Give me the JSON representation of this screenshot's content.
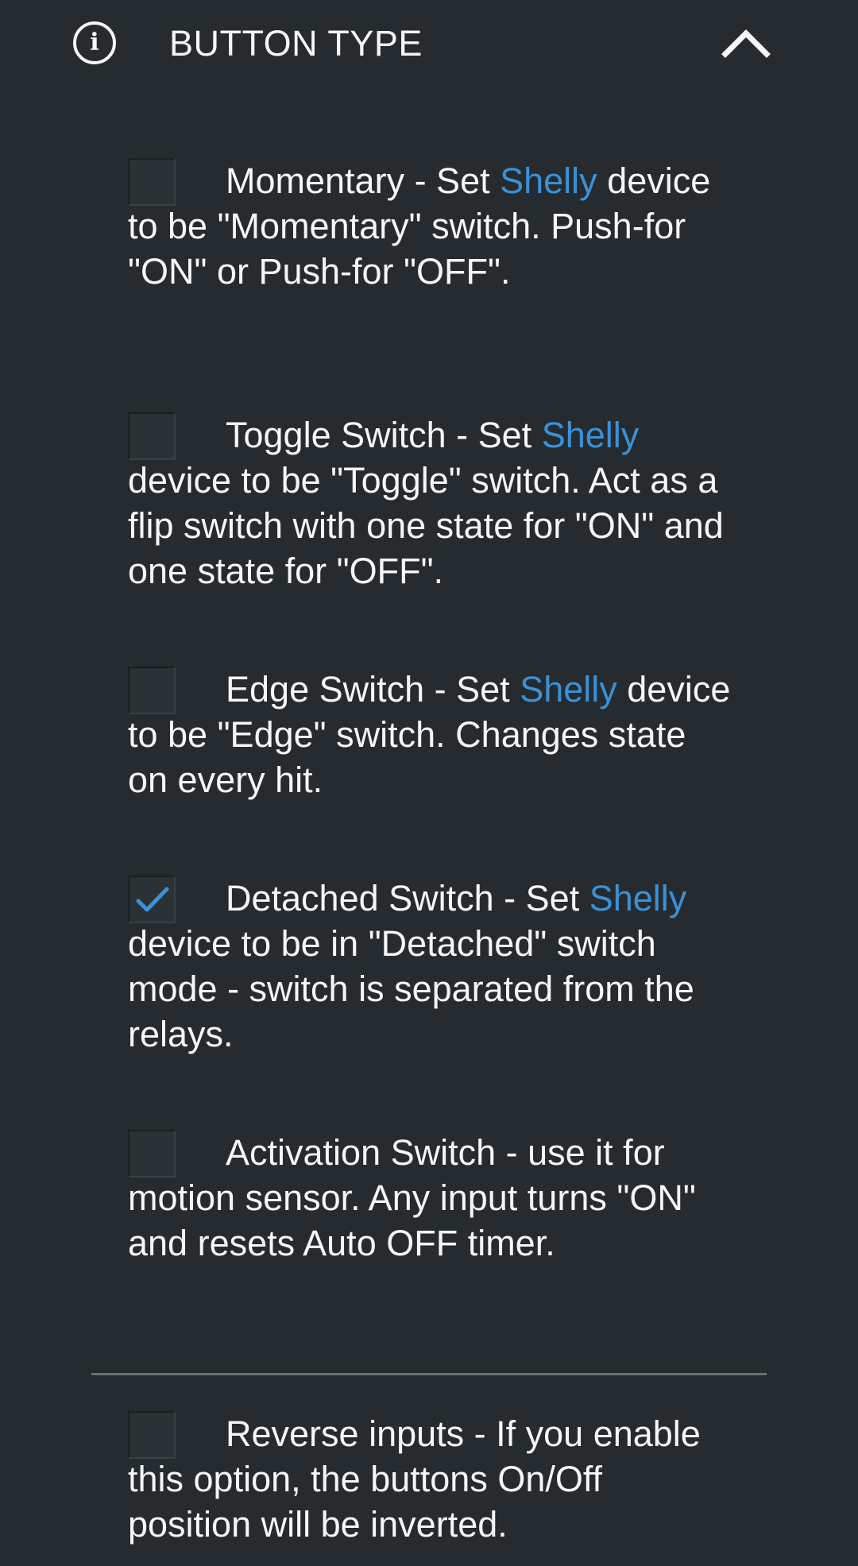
{
  "section": {
    "title": "BUTTON TYPE",
    "info_icon_glyph": "i",
    "info_icon": "info-circle-icon",
    "collapse_icon": "chevron-up-icon"
  },
  "colors": {
    "background": "#252b2e",
    "text": "#f4f6f7",
    "link": "#3a91d8",
    "check": "#3a91d8",
    "divider": "#6b7073"
  },
  "options": [
    {
      "checked": false,
      "title_prefix": "Momentary - Set ",
      "link_text": "Shelly",
      "text_after": " device to be \"Momentary\" switch. Push-for \"ON\" or Push-for \"OFF\"."
    },
    {
      "checked": false,
      "title_prefix": "Toggle Switch - Set ",
      "link_text": "Shelly",
      "text_after": " device to be \"Toggle\" switch. Act as a flip switch with one state for \"ON\" and one state for \"OFF\"."
    },
    {
      "checked": false,
      "title_prefix": "Edge Switch - Set ",
      "link_text": "Shelly",
      "text_after": " device to be \"Edge\" switch. Changes state on every hit."
    },
    {
      "checked": true,
      "title_prefix": "Detached Switch - Set ",
      "link_text": "Shelly",
      "text_after": " device to be in \"Detached\" switch mode - switch is separated from the relays."
    },
    {
      "checked": false,
      "title_prefix": "Activation Switch - use it for motion sensor. Any input turns \"ON\" and resets Auto OFF timer.",
      "link_text": "",
      "text_after": ""
    }
  ],
  "reverse_inputs": {
    "checked": false,
    "text": "Reverse inputs - If you enable this option, the buttons On/Off position will be inverted."
  }
}
